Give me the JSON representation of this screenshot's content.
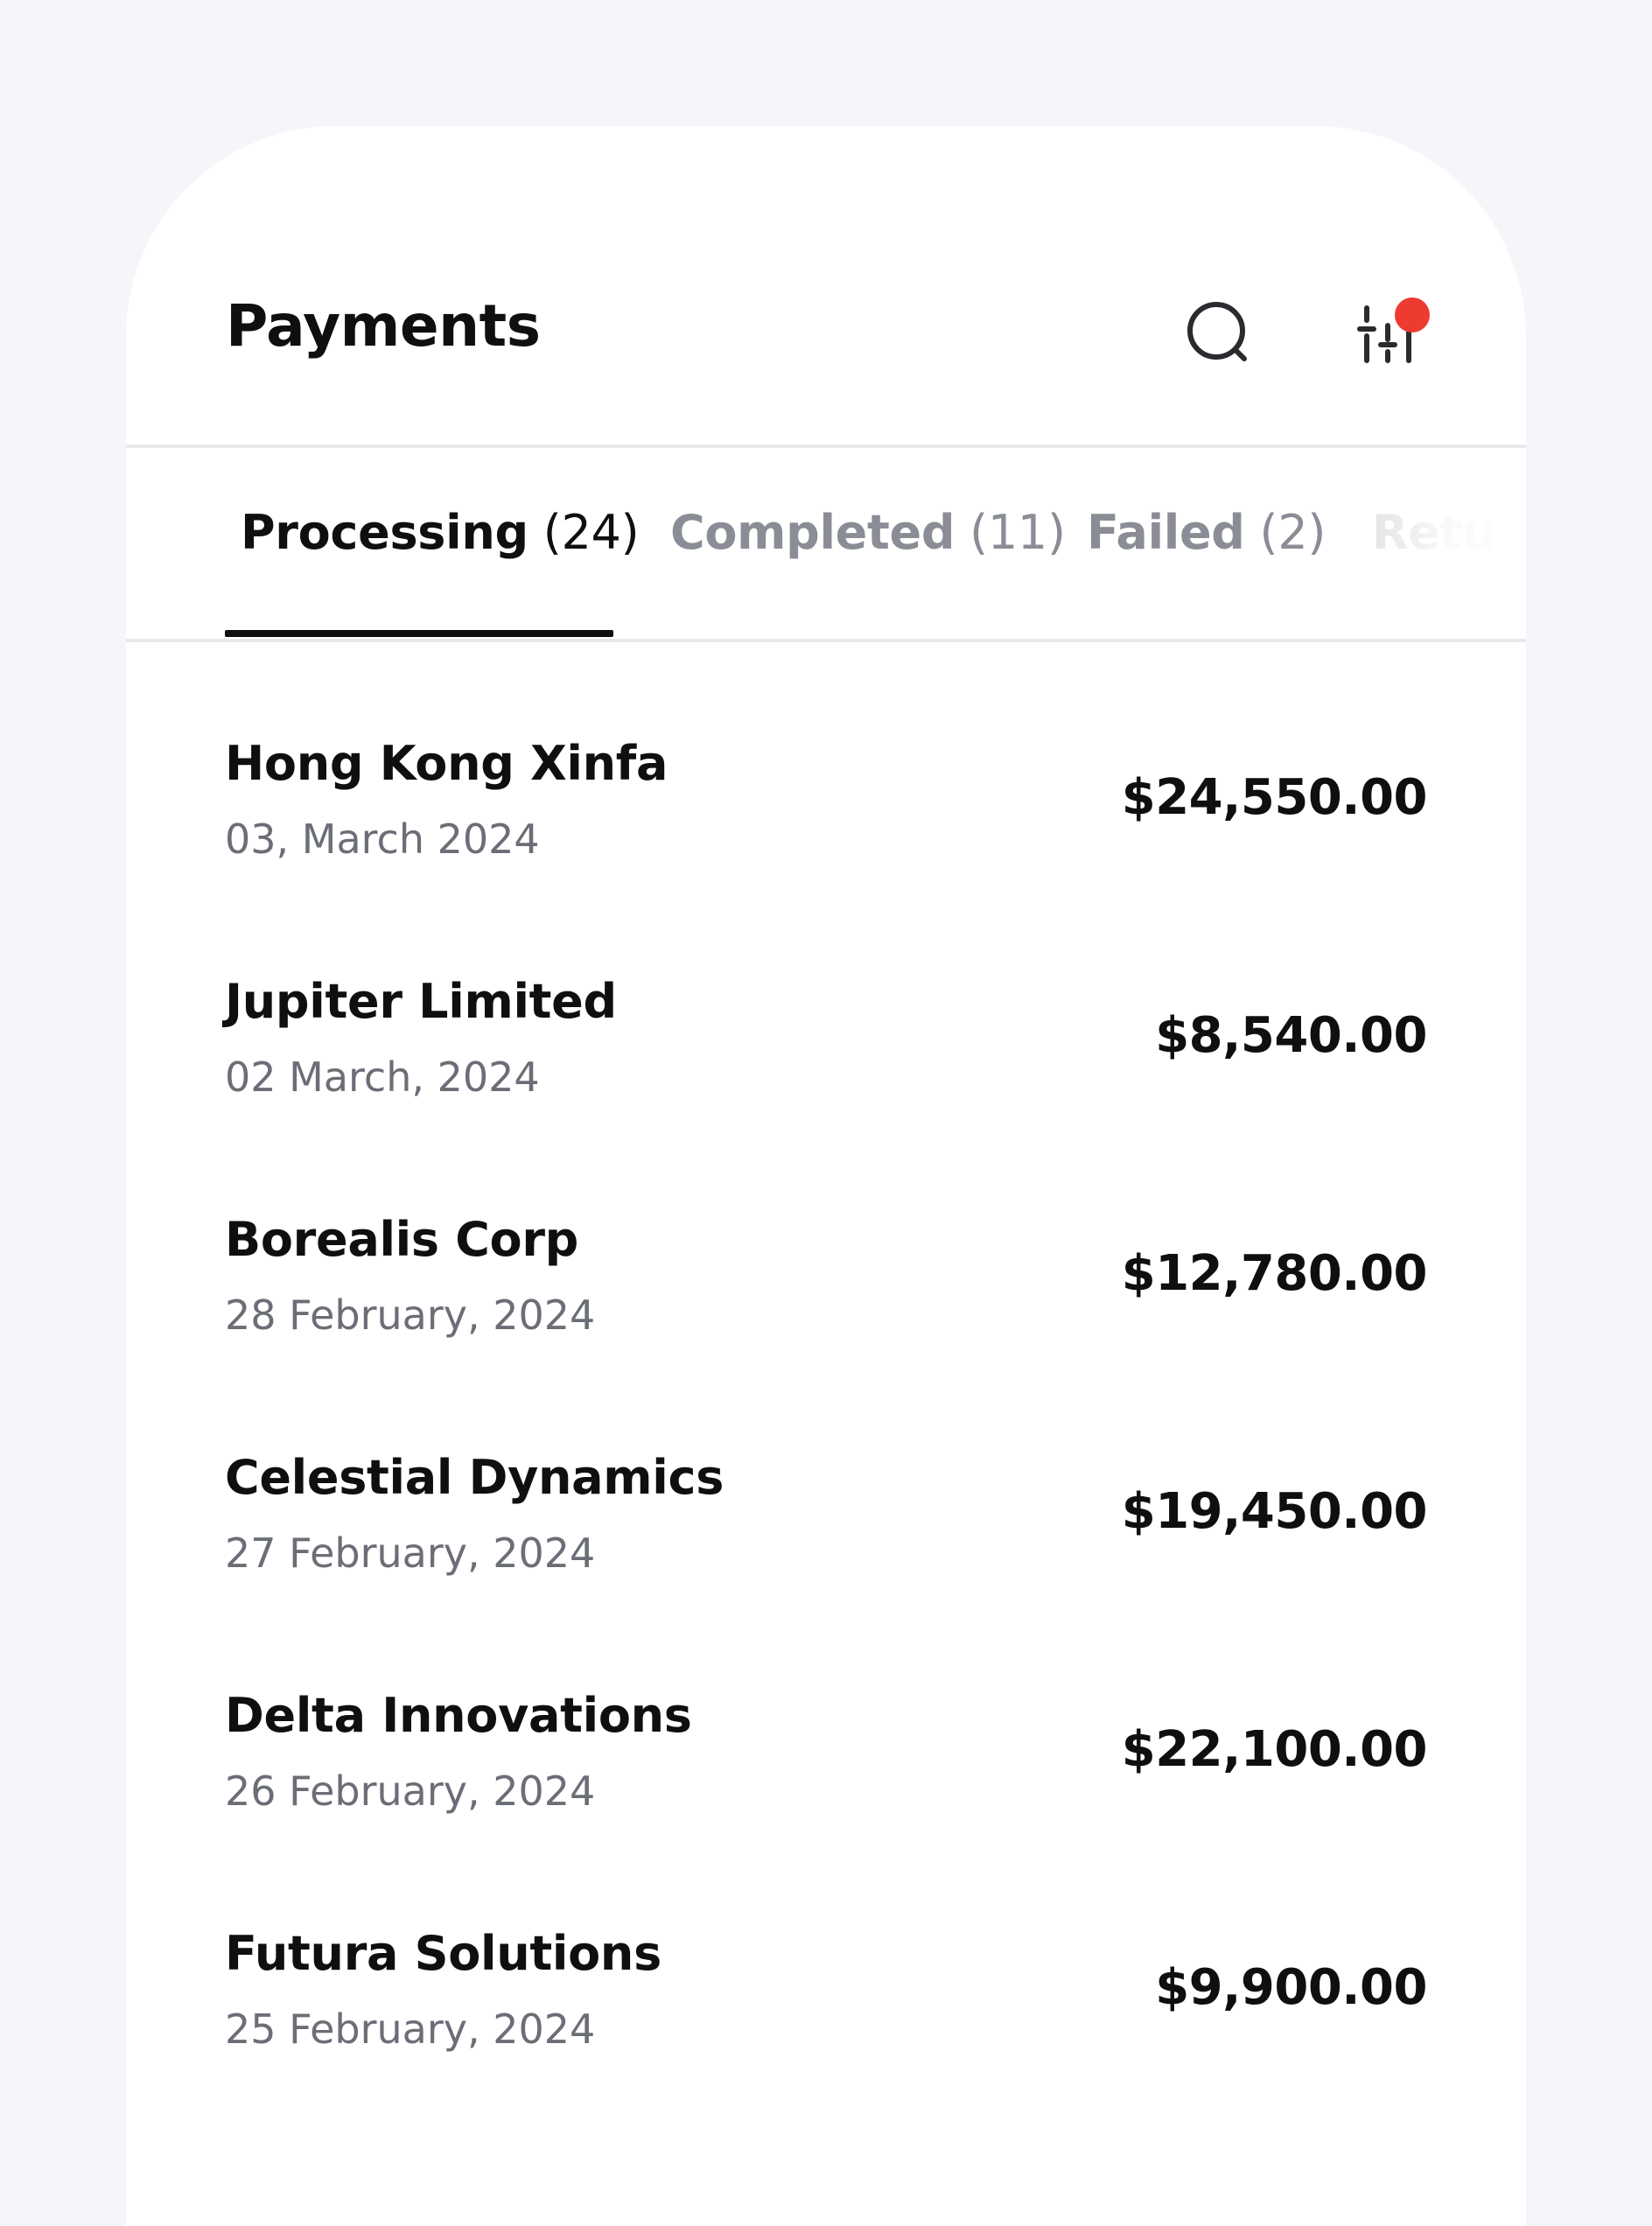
{
  "header": {
    "title": "Payments",
    "search_icon": "search-icon",
    "filter_icon": "sliders-icon",
    "notification_color": "#ee3b2f"
  },
  "tabs": [
    {
      "label": "Processing",
      "count": "(24)",
      "active": true
    },
    {
      "label": "Completed",
      "count": "(11)",
      "active": false
    },
    {
      "label": "Failed",
      "count": "(2)",
      "active": false
    },
    {
      "label": "Retu",
      "count": "",
      "active": false
    }
  ],
  "payments": [
    {
      "name": "Hong Kong Xinfa",
      "date": "03, March 2024",
      "amount": "$24,550.00"
    },
    {
      "name": "Jupiter Limited",
      "date": "02 March, 2024",
      "amount": "$8,540.00"
    },
    {
      "name": "Borealis Corp",
      "date": "28 February, 2024",
      "amount": "$12,780.00"
    },
    {
      "name": "Celestial Dynamics",
      "date": "27 February, 2024",
      "amount": "$19,450.00"
    },
    {
      "name": "Delta Innovations",
      "date": "26 February, 2024",
      "amount": "$22,100.00"
    },
    {
      "name": "Futura Solutions",
      "date": "25 February, 2024",
      "amount": "$9,900.00"
    }
  ],
  "colors": {
    "background": "#f5f6f9",
    "card": "#ffffff",
    "text_primary": "#0f0f10",
    "text_secondary": "#6b6e76",
    "tab_inactive": "#8a8d95",
    "accent_dot": "#ee3b2f"
  }
}
